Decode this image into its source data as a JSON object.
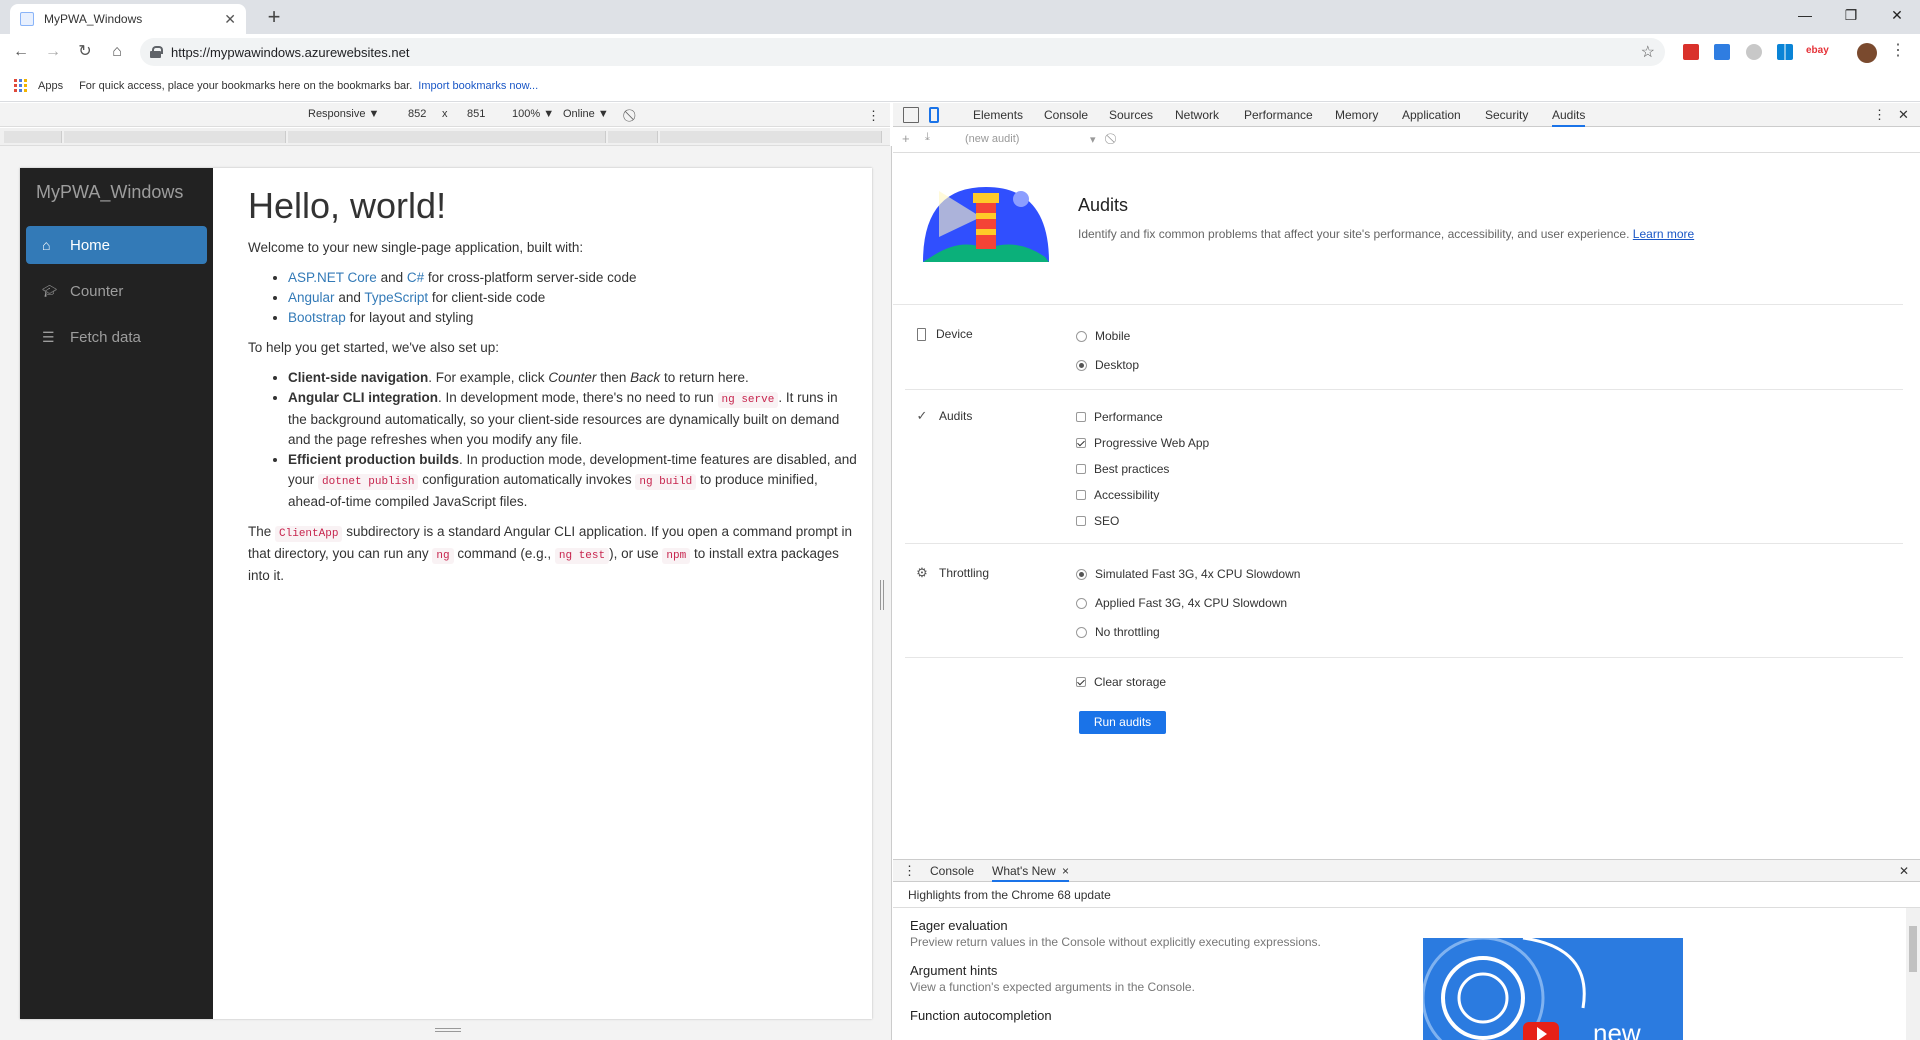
{
  "browser": {
    "tab_title": "MyPWA_Windows",
    "new_tab": "+",
    "url": "https://mypwawindows.azurewebsites.net",
    "bookmarks_apps": "Apps",
    "bookmarks_hint": "For quick access, place your bookmarks here on the bookmarks bar.",
    "bookmarks_import": "Import bookmarks now...",
    "extensions": [
      "ext-red-icon",
      "ext-blue-d-icon",
      "ext-grey-icon",
      "ext-windows-icon",
      "ext-ebay-icon"
    ],
    "ebay_label": "ebay"
  },
  "device_toolbar": {
    "mode": "Responsive ▼",
    "width": "852",
    "times": "x",
    "height": "851",
    "zoom": "100% ▼",
    "network": "Online ▼"
  },
  "app": {
    "brand": "MyPWA_Windows",
    "nav": [
      {
        "label": "Home",
        "icon": "home-icon",
        "active": true
      },
      {
        "label": "Counter",
        "icon": "graduation-cap-icon",
        "active": false
      },
      {
        "label": "Fetch data",
        "icon": "list-icon",
        "active": false
      }
    ],
    "heading": "Hello, world!",
    "intro": "Welcome to your new single-page application, built with:",
    "built_with": {
      "aspnet": "ASP.NET Core",
      "and1": "and",
      "csharp": "C#",
      "rest1": "for cross-platform server-side code",
      "angular": "Angular",
      "and2": "and",
      "typescript": "TypeScript",
      "rest2": "for client-side code",
      "bootstrap": "Bootstrap",
      "rest3": "for layout and styling"
    },
    "setup_intro": "To help you get started, we've also set up:",
    "features": {
      "f1_bold": "Client-side navigation",
      "f1_a": ". For example, click",
      "f1_counter": "Counter",
      "f1_b": "then",
      "f1_back": "Back",
      "f1_c": "to return here.",
      "f2_bold": "Angular CLI integration",
      "f2_a": ". In development mode, there's no need to run",
      "f2_code": "ng serve",
      "f2_b": ". It runs in the background automatically, so your client-side resources are dynamically built on demand and the page refreshes when you modify any file.",
      "f3_bold": "Efficient production builds",
      "f3_a": ". In production mode, development-time features are disabled, and your",
      "f3_code1": "dotnet publish",
      "f3_b": "configuration automatically invokes",
      "f3_code2": "ng build",
      "f3_c": "to produce minified, ahead-of-time compiled JavaScript files."
    },
    "closing": {
      "a": "The",
      "code1": "ClientApp",
      "b": "subdirectory is a standard Angular CLI application. If you open a command prompt in that directory, you can run any",
      "code2": "ng",
      "c": "command (e.g.,",
      "code3": "ng test",
      "d": "), or use",
      "code4": "npm",
      "e": "to install extra packages into it."
    }
  },
  "devtools": {
    "tabs": [
      "Elements",
      "Console",
      "Sources",
      "Network",
      "Performance",
      "Memory",
      "Application",
      "Security",
      "Audits"
    ],
    "selected_tab": "Audits",
    "sub_select": "(new audit)",
    "audits_title": "Audits",
    "audits_desc": "Identify and fix common problems that affect your site's performance, accessibility, and user experience.",
    "learn_more": "Learn more",
    "device": {
      "label": "Device",
      "options": [
        {
          "label": "Mobile",
          "checked": false
        },
        {
          "label": "Desktop",
          "checked": true
        }
      ]
    },
    "audits": {
      "label": "Audits",
      "options": [
        {
          "label": "Performance",
          "checked": false
        },
        {
          "label": "Progressive Web App",
          "checked": true
        },
        {
          "label": "Best practices",
          "checked": false
        },
        {
          "label": "Accessibility",
          "checked": false
        },
        {
          "label": "SEO",
          "checked": false
        }
      ]
    },
    "throttling": {
      "label": "Throttling",
      "options": [
        {
          "label": "Simulated Fast 3G, 4x CPU Slowdown",
          "checked": true
        },
        {
          "label": "Applied Fast 3G, 4x CPU Slowdown",
          "checked": false
        },
        {
          "label": "No throttling",
          "checked": false
        }
      ]
    },
    "clear_storage": {
      "label": "Clear storage",
      "checked": true
    },
    "run_button": "Run audits",
    "drawer": {
      "tabs": [
        "Console",
        "What's New"
      ],
      "selected": "What's New",
      "close_x": "×",
      "highlights": "Highlights from the Chrome 68 update",
      "items": [
        {
          "title": "Eager evaluation",
          "desc": "Preview return values in the Console without explicitly executing expressions."
        },
        {
          "title": "Argument hints",
          "desc": "View a function's expected arguments in the Console."
        },
        {
          "title": "Function autocompletion",
          "desc": ""
        }
      ],
      "video_text": "new"
    }
  },
  "colors": {
    "accent": "#1a73e8",
    "sidebar_bg": "#222222",
    "nav_active": "#337ab7",
    "link": "#337ab7",
    "code": "#c7254e"
  }
}
